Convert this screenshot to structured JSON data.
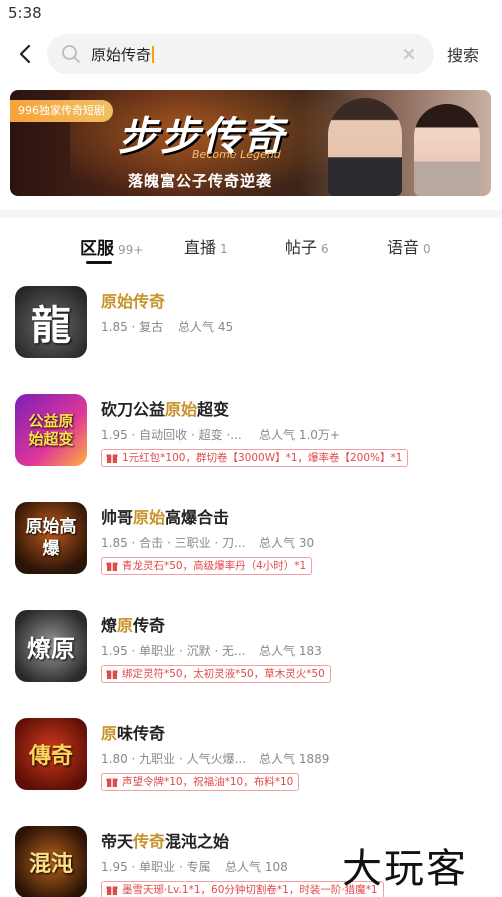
{
  "status_bar": {
    "time": "5:38"
  },
  "search": {
    "query": "原始传奇",
    "button_label": "搜索"
  },
  "banner": {
    "tag": "996独家传奇短剧",
    "title": "步步传奇",
    "subtitle_en": "Become Legend",
    "subtitle": "落魄富公子传奇逆袭"
  },
  "tabs": [
    {
      "label": "区服",
      "count": "99+"
    },
    {
      "label": "直播",
      "count": "1"
    },
    {
      "label": "帖子",
      "count": "6"
    },
    {
      "label": "语音",
      "count": "0"
    }
  ],
  "colors": {
    "highlight": "#c8922a",
    "gift_red": "#e04a4a",
    "accent_caret": "#f2a700"
  },
  "games": [
    {
      "name_parts": [
        "",
        "原始传奇",
        ""
      ],
      "meta": "1.85 · 复古",
      "popularity": "总人气 45",
      "gift": "",
      "icon_text": "龍"
    },
    {
      "name_parts": [
        "砍刀公益",
        "原始",
        "超变"
      ],
      "meta": "1.95 · 自动回收 · 超变 ·...",
      "popularity": "总人气 1.0万+",
      "gift": "1元红包*100，群切卷【3000W】*1，爆率卷【200%】*1",
      "icon_text": "公益原始超变"
    },
    {
      "name_parts": [
        "帅哥",
        "原始",
        "高爆合击"
      ],
      "meta": "1.85 · 合击 · 三职业 · 刀...",
      "popularity": "总人气 30",
      "gift": "青龙灵石*50，高级爆率丹（4小时）*1",
      "icon_text": "原始高爆"
    },
    {
      "name_parts": [
        "燎",
        "原",
        "传奇"
      ],
      "meta": "1.95 · 单职业 · 沉默 · 无...",
      "popularity": "总人气 183",
      "gift": "绑定灵符*50，太初灵液*50，草木灵火*50",
      "icon_text": "燎原"
    },
    {
      "name_parts": [
        "",
        "原",
        "味传奇"
      ],
      "meta": "1.80 · 九职业 · 人气火爆...",
      "popularity": "总人气 1889",
      "gift": "声望令牌*10，祝福油*10，布料*10",
      "icon_text": "傳奇"
    },
    {
      "name_parts": [
        "帝天",
        "传奇",
        "混沌之始"
      ],
      "meta": "1.95 · 单职业 · 专属",
      "popularity": "总人气 108",
      "gift": "墨雪天琊·Lv.1*1，60分钟切割卷*1，时装一阶·猎魔*1",
      "icon_text": "混沌"
    }
  ],
  "watermark": "大玩客"
}
